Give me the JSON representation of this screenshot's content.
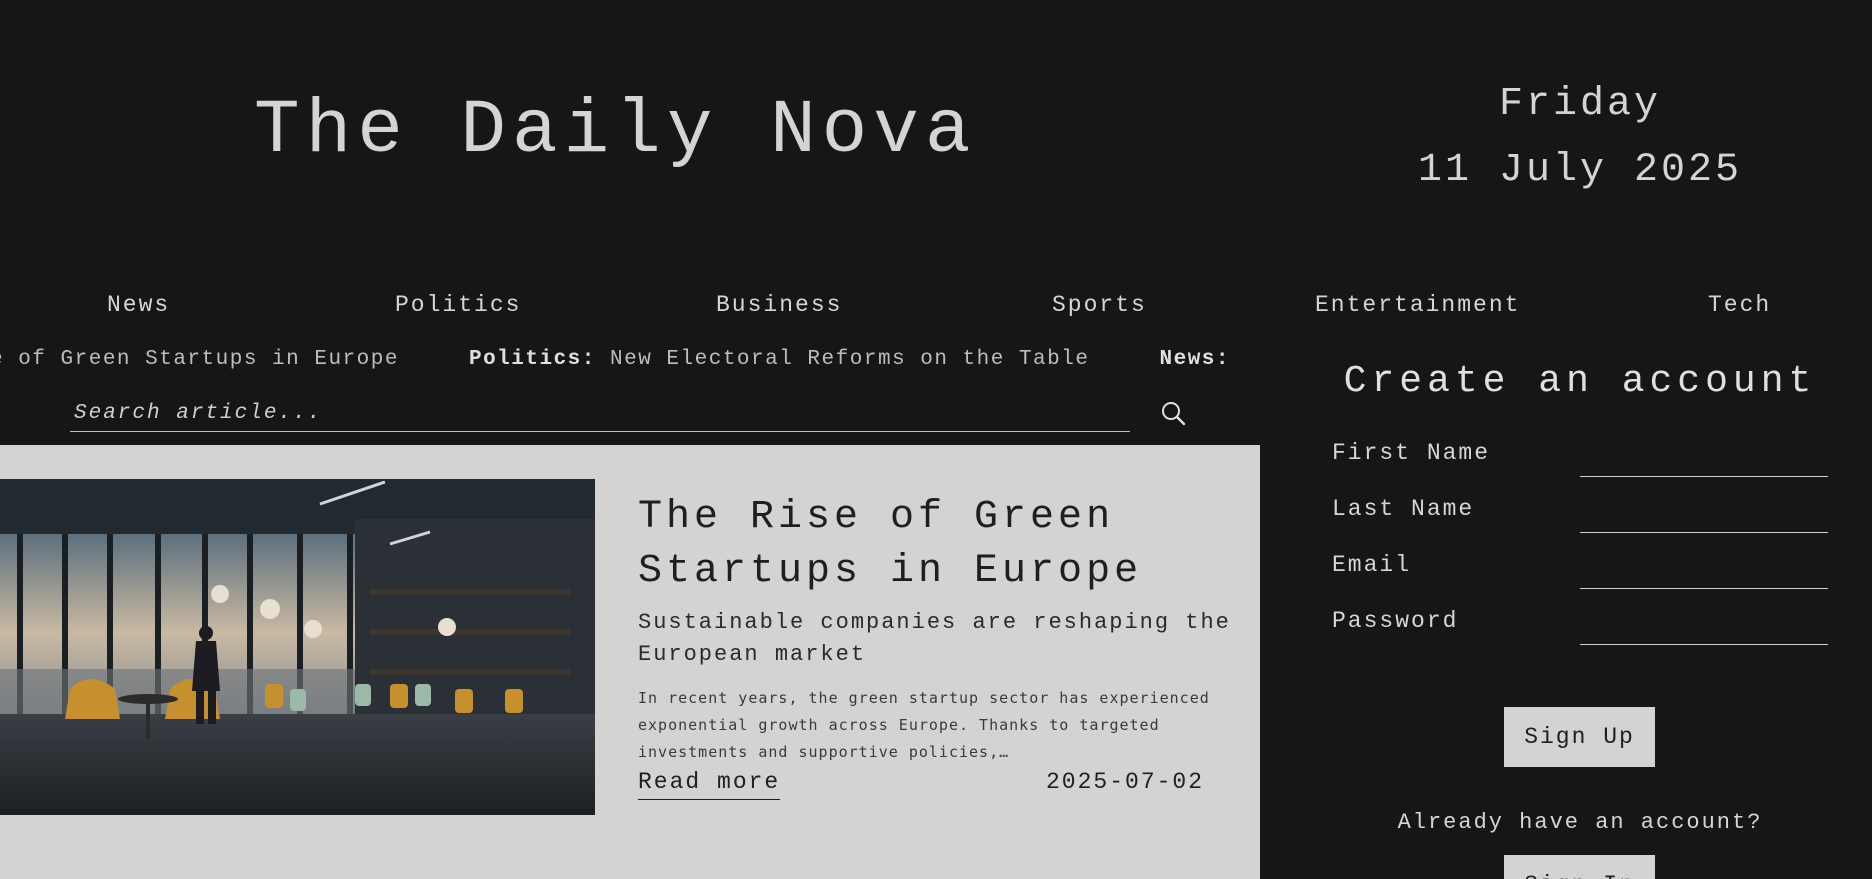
{
  "header": {
    "title": "The Daily Nova",
    "weekday": "Friday",
    "date": "11 July 2025"
  },
  "nav": {
    "items": [
      "News",
      "Politics",
      "Business",
      "Sports",
      "Entertainment",
      "Tech"
    ]
  },
  "ticker": {
    "items": [
      {
        "category": "",
        "headline": "e of Green Startups in Europe"
      },
      {
        "category": "Politics:",
        "headline": "New Electoral Reforms on the Table"
      },
      {
        "category": "News:",
        "headline": ""
      }
    ]
  },
  "search": {
    "placeholder": "Search article..."
  },
  "article": {
    "title": "The Rise of Green Startups in Europe",
    "subtitle": "Sustainable companies are reshaping the European market",
    "body": "In recent years, the green startup sector has experienced exponential growth across Europe. Thanks to targeted investments and supportive policies,…",
    "read_more": "Read more",
    "date": "2025-07-02"
  },
  "signup": {
    "title": "Create an account",
    "fields": {
      "first_name": "First Name",
      "last_name": "Last Name",
      "email": "Email",
      "password": "Password"
    },
    "signup_button": "Sign Up",
    "already": "Already have an account?",
    "signin_button": "Sign In"
  }
}
